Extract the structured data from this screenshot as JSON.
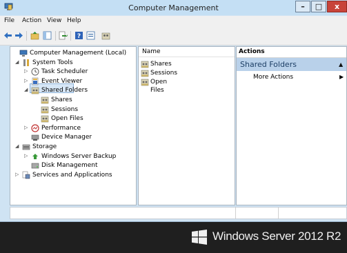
{
  "window": {
    "title": "Computer Management"
  },
  "window_controls": {
    "minimize": "–",
    "maximize": "□",
    "close": "x"
  },
  "menu": [
    "File",
    "Action",
    "View",
    "Help"
  ],
  "toolbar_icons": [
    "back-arrow-icon",
    "forward-arrow-icon",
    "folder-up-icon",
    "show-hide-tree-icon",
    "export-list-icon",
    "help-icon",
    "properties-icon",
    "shared-folder-icon"
  ],
  "tree": [
    {
      "label": "Computer Management (Local)",
      "icon": "computer-management-icon",
      "arrow": ""
    },
    {
      "label": "System Tools",
      "icon": "tools-icon",
      "arrow": "◢"
    },
    {
      "label": "Task Scheduler",
      "icon": "clock-icon",
      "arrow": "▷"
    },
    {
      "label": "Event Viewer",
      "icon": "event-viewer-icon",
      "arrow": "▷"
    },
    {
      "label": "Shared Folders",
      "icon": "shared-folder-icon",
      "arrow": "◢",
      "selected": true
    },
    {
      "label": "Shares",
      "icon": "shared-folder-icon",
      "arrow": ""
    },
    {
      "label": "Sessions",
      "icon": "shared-folder-icon",
      "arrow": ""
    },
    {
      "label": "Open Files",
      "icon": "shared-folder-icon",
      "arrow": ""
    },
    {
      "label": "Performance",
      "icon": "performance-icon",
      "arrow": "▷"
    },
    {
      "label": "Device Manager",
      "icon": "device-manager-icon",
      "arrow": ""
    },
    {
      "label": "Storage",
      "icon": "storage-icon",
      "arrow": "◢"
    },
    {
      "label": "Windows Server Backup",
      "icon": "backup-icon",
      "arrow": "▷"
    },
    {
      "label": "Disk Management",
      "icon": "disk-icon",
      "arrow": ""
    },
    {
      "label": "Services and Applications",
      "icon": "services-icon",
      "arrow": "▷"
    }
  ],
  "list": {
    "header": "Name",
    "items": [
      "Shares",
      "Sessions",
      "Open Files"
    ]
  },
  "actions": {
    "header": "Actions",
    "group": "Shared Folders",
    "group_caret": "▲",
    "item": "More Actions",
    "item_caret": "▶"
  },
  "branding": {
    "text": "Windows Server 2012 R2"
  },
  "colors": {
    "title_bar": "#c4dff4",
    "close_button": "#c8443a",
    "selection": "#d7e7f7",
    "actions_group": "#b9d1ea",
    "desktop": "#1f1f1f"
  }
}
